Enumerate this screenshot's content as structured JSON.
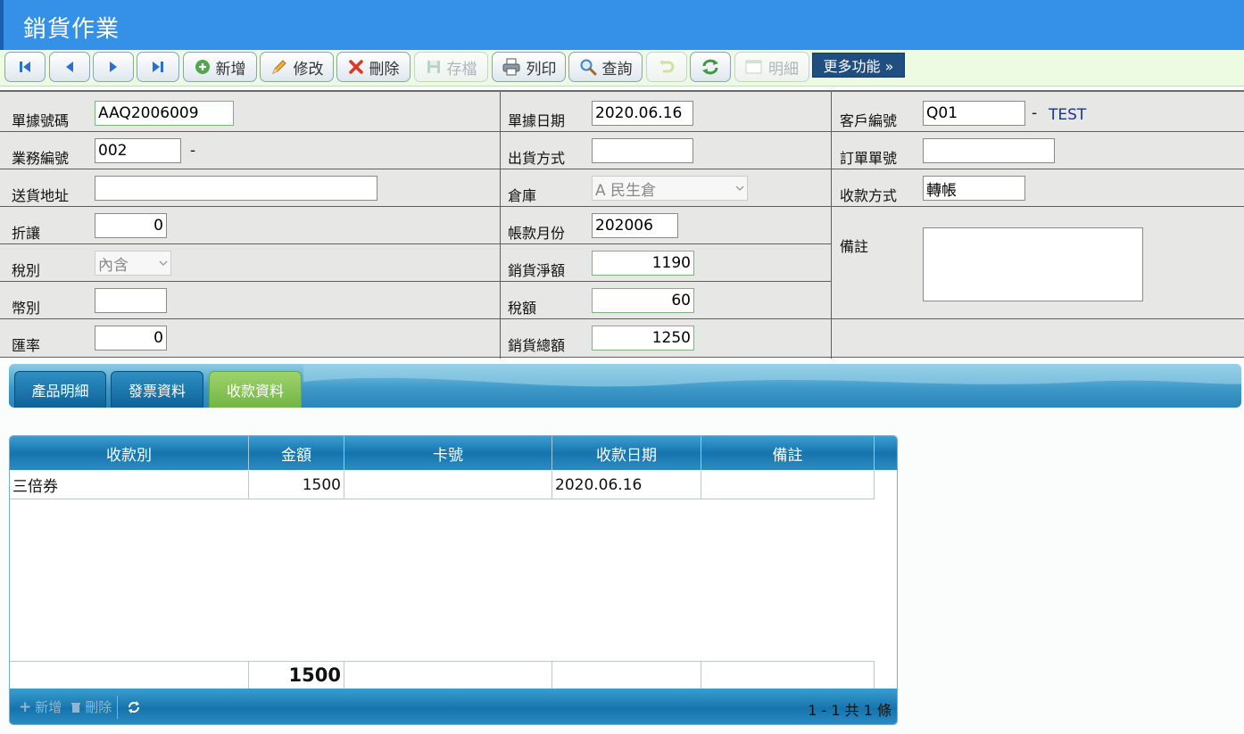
{
  "title": "銷貨作業",
  "toolbar": {
    "add": "新增",
    "edit": "修改",
    "delete": "刪除",
    "save": "存檔",
    "print": "列印",
    "query": "查詢",
    "detail": "明細",
    "more": "更多功能 »"
  },
  "form": {
    "doc_no_label": "單據號碼",
    "doc_no": "AAQ2006009",
    "doc_date_label": "單據日期",
    "doc_date": "2020.06.16",
    "customer_no_label": "客戶編號",
    "customer_no": "Q01",
    "customer_name": "TEST",
    "sales_no_label": "業務編號",
    "sales_no": "002",
    "ship_method_label": "出貨方式",
    "ship_method": "",
    "order_no_label": "訂單單號",
    "order_no": "",
    "address_label": "送貨地址",
    "address": "",
    "warehouse_label": "倉庫",
    "warehouse": "A 民生倉",
    "payment_method_label": "收款方式",
    "payment_method": "轉帳",
    "discount_label": "折讓",
    "discount": "0",
    "account_month_label": "帳款月份",
    "account_month": "202006",
    "remark_label": "備註",
    "remark": "",
    "tax_type_label": "稅別",
    "tax_type": "內含",
    "net_sales_label": "銷貨淨額",
    "net_sales": "1190",
    "currency_label": "幣別",
    "currency": "",
    "tax_label": "稅額",
    "tax": "60",
    "rate_label": "匯率",
    "rate": "0",
    "total_label": "銷貨總額",
    "total": "1250"
  },
  "tabs": [
    "產品明細",
    "發票資料",
    "收款資料"
  ],
  "grid": {
    "columns": [
      "收款別",
      "金額",
      "卡號",
      "收款日期",
      "備註"
    ],
    "rows": [
      {
        "type": "三倍券",
        "amount": "1500",
        "card": "",
        "date": "2020.06.16",
        "note": ""
      }
    ],
    "sum_amount": "1500",
    "pager_add": "新增",
    "pager_delete": "刪除",
    "pager_info": "1 - 1 共 1 條"
  },
  "colors": {
    "title_bar": "#3590e8",
    "toolbar_bg": "#edfbe2",
    "tab_active": "#8dc85a",
    "grid_header": "#1674ad"
  }
}
